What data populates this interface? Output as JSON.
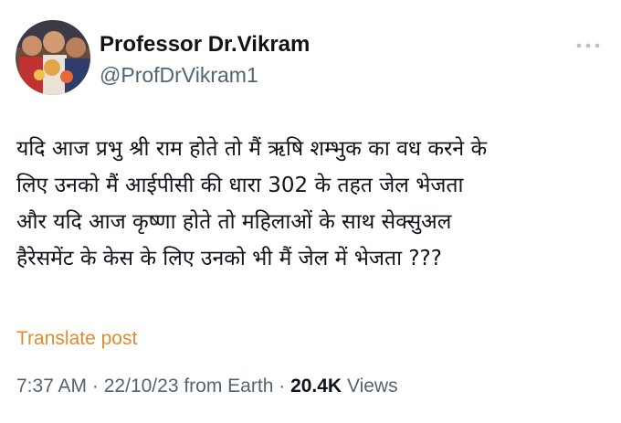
{
  "author": {
    "display_name": "Professor Dr.Vikram",
    "handle": "@ProfDrVikram1",
    "avatar_icon": "profile-photo"
  },
  "menu": {
    "more_icon": "more-dots-icon"
  },
  "post": {
    "lines": [
      "यदि आज प्रभु श्री राम होते तो मैं ऋषि शम्भुक का वध करने के",
      "लिए उनको मैं आईपीसी की धारा 302 के तहत जेल भेजता",
      "और यदि आज कृष्णा होते तो महिलाओं के साथ सेक्सुअल",
      "हैरेसमेंट के केस के लिए उनको भी मैं जेल में भेजता ???"
    ]
  },
  "translate": {
    "label": "Translate post"
  },
  "meta": {
    "time": "7:37 AM",
    "date": "22/10/23",
    "source": "from Earth",
    "views_count": "20.4K",
    "views_label": "Views",
    "separator": "·"
  },
  "colors": {
    "text": "#0f1419",
    "secondary": "#536471",
    "translate_link": "#e08b2c",
    "background": "#ffffff"
  }
}
